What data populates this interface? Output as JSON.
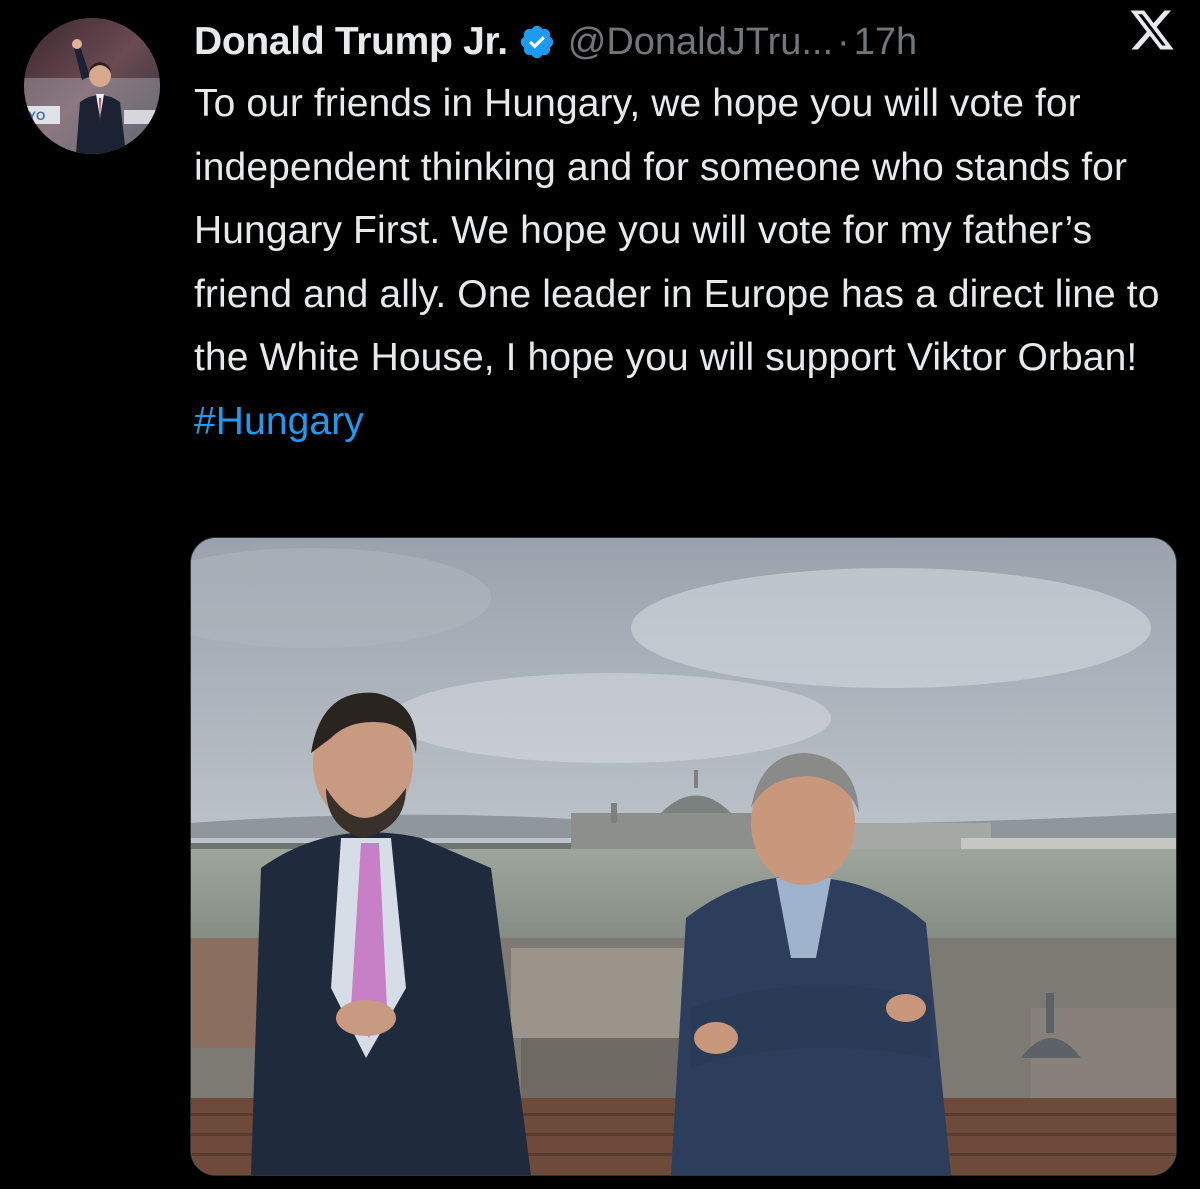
{
  "tweet": {
    "author": {
      "display_name": "Donald Trump Jr.",
      "handle": "@DonaldJTru...",
      "verified": true,
      "avatar_icon": "profile-photo-icon"
    },
    "separator": "·",
    "timestamp": "17h",
    "platform_icon": "x-logo-icon",
    "text_main": "To our friends in Hungary, we hope you will vote for independent thinking and for someone who stands for Hungary First. We hope you will vote for my father’s friend and ally. One leader in Europe has a direct line to the White House, I hope you will support Viktor Orban!",
    "hashtag": "#Hungary",
    "media": {
      "type": "photo",
      "alt_icon": "photo-icon"
    }
  },
  "colors": {
    "background": "#000000",
    "text": "#e7e9ea",
    "muted": "#71767b",
    "link": "#1d9bf0",
    "verified_badge": "#1d9bf0"
  }
}
